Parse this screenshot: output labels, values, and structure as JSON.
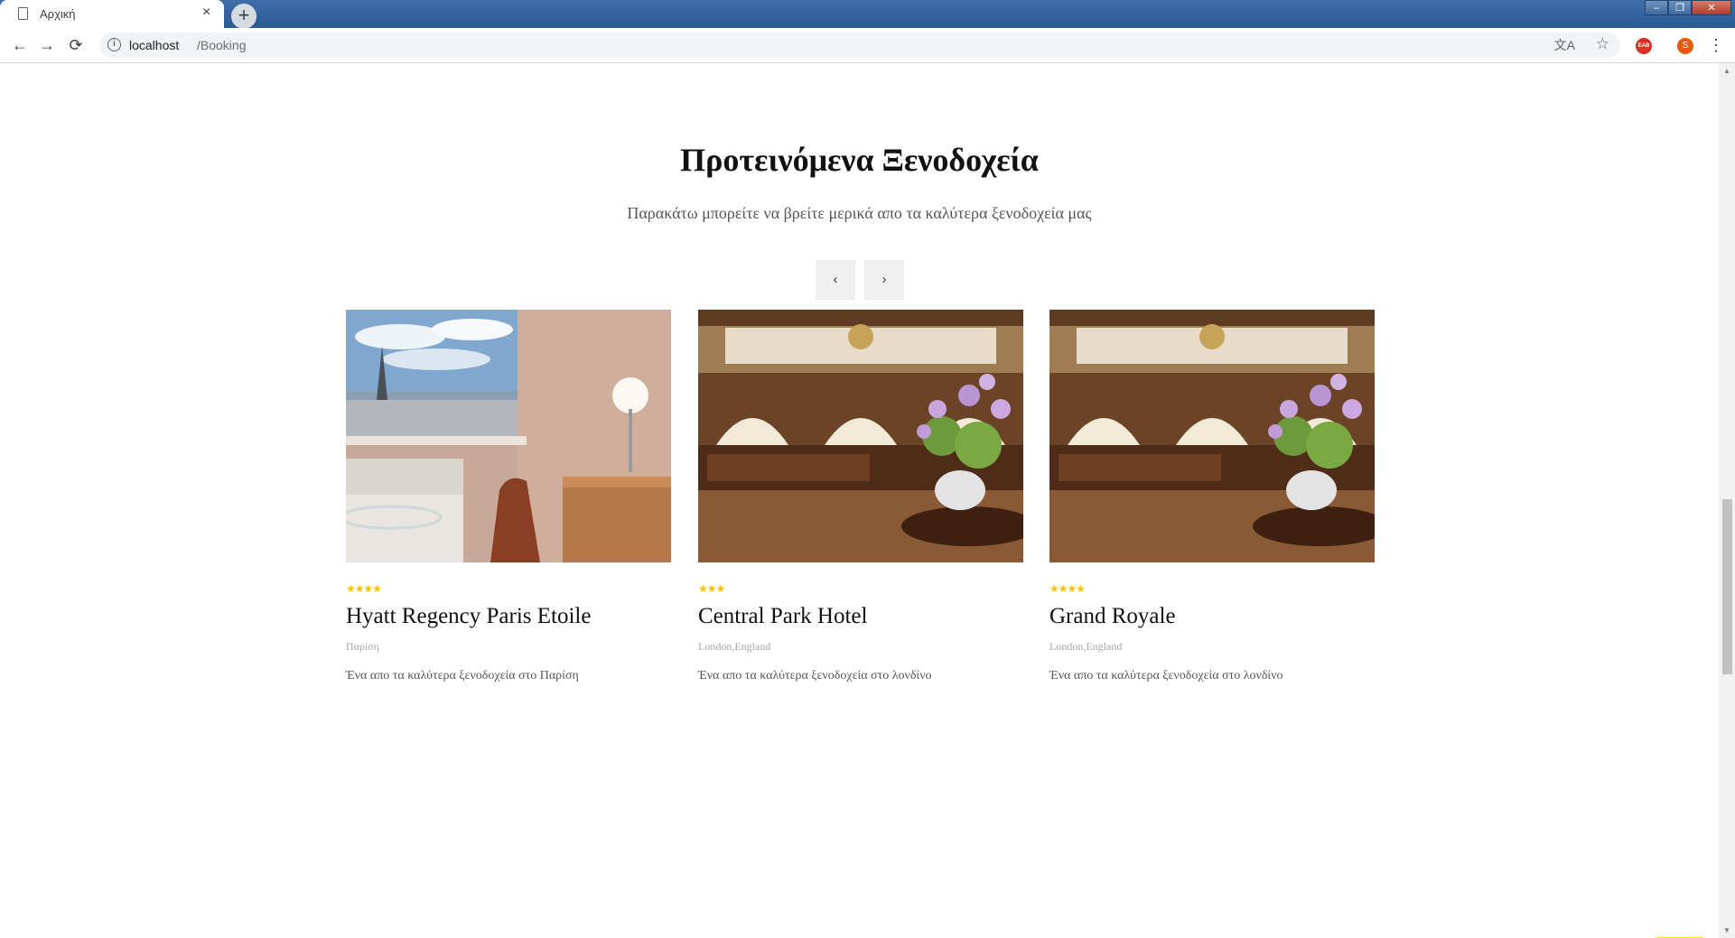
{
  "browser": {
    "tab_title": "Αρχική",
    "tab_close": "×",
    "new_tab": "+",
    "window_controls": {
      "minimize": "–",
      "maximize": "❐",
      "close": "✕"
    },
    "nav": {
      "back": "←",
      "forward": "→",
      "reload": "⟳"
    },
    "url_host": "localhost",
    "url_path": "/Booking",
    "info_icon": "i",
    "translate_icon": "文A",
    "star_icon": "☆",
    "extension_label": "EAB",
    "profile_initial": "S",
    "menu": "⋮"
  },
  "section": {
    "title": "Προτεινόμενα Ξενοδοχεία",
    "subtitle": "Παρακάτω μπορείτε να βρείτε μερικά απο τα καλύτερα ξενοδοχεία μας",
    "prev": "‹",
    "next": "›"
  },
  "hotels": [
    {
      "name": "Hyatt Regency Paris Etoile",
      "location": "Παρίση",
      "description": "Ένα απο τα καλύτερα ξενοδοχεία στο Παρίση",
      "stars": "★★★★",
      "rating": 4,
      "image": "hotel room with eiffel tower view"
    },
    {
      "name": "Central Park Hotel",
      "location": "London,England",
      "description": "Ένα απο τα καλύτερα ξενοδοχεία στο λονδίνο",
      "stars": "★★★",
      "rating": 3,
      "image": "grand hotel lobby with flowers"
    },
    {
      "name": "Grand Royale",
      "location": "London,England",
      "description": "Ένα απο τα καλύτερα ξενοδοχεία στο λονδίνο",
      "stars": "★★★★",
      "rating": 4,
      "image": "grand hotel lobby with flowers"
    }
  ],
  "scrollbar": {
    "up": "▲",
    "down": "▼"
  },
  "back_to_top": "↑",
  "colors": {
    "accent": "#ffd800",
    "stars": "#f5c300",
    "chrome_blue": "#2a5a92"
  }
}
